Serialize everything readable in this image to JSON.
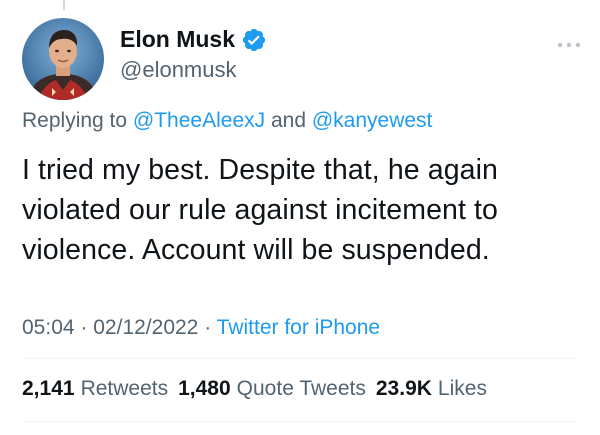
{
  "author": {
    "display_name": "Elon Musk",
    "handle": "@elonmusk",
    "verified_icon": "verified-badge-icon"
  },
  "reply": {
    "prefix": "Replying to",
    "mention1": "@TheeAleexJ",
    "conjunction": "and",
    "mention2": "@kanyewest"
  },
  "tweet": {
    "text": "I tried my best. Despite that, he again violated our rule against incitement to violence. Account will be suspended."
  },
  "meta": {
    "time": "05:04",
    "separator1": "·",
    "date": "02/12/2022",
    "separator2": "·",
    "source": "Twitter for iPhone"
  },
  "stats": {
    "retweets_count": "2,141",
    "retweets_label": "Retweets",
    "quotes_count": "1,480",
    "quotes_label": "Quote Tweets",
    "likes_count": "23.9K",
    "likes_label": "Likes"
  },
  "colors": {
    "accent": "#1d9bf0",
    "secondary_text": "#536471",
    "primary_text": "#0f1419",
    "divider": "#eff3f4"
  }
}
